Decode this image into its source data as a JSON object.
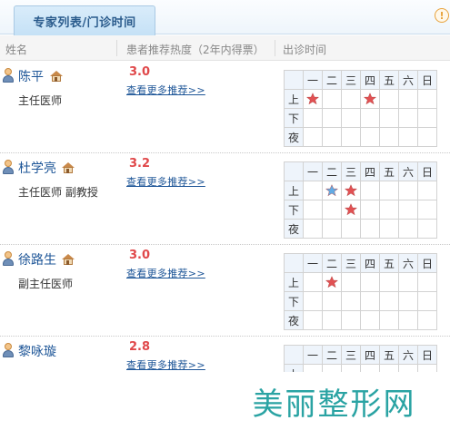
{
  "tab": {
    "label": "专家列表/门诊时间",
    "info_icon": "!"
  },
  "header": {
    "name_col": "姓名",
    "rating_col": "患者推荐热度（2年内得票）",
    "schedule_col": "出诊时间"
  },
  "schedule_labels": {
    "days": [
      "一",
      "二",
      "三",
      "四",
      "五",
      "六",
      "日"
    ],
    "slots": [
      "上",
      "下",
      "夜"
    ]
  },
  "doctors": [
    {
      "name": "陈平",
      "title": "主任医师",
      "score": "3.0",
      "more": "查看更多推荐>>",
      "schedule": [
        [
          "red",
          "",
          "",
          "red",
          "",
          "",
          ""
        ],
        [
          "",
          "",
          "",
          "",
          "",
          "",
          ""
        ],
        [
          "",
          "",
          "",
          "",
          "",
          "",
          ""
        ]
      ]
    },
    {
      "name": "杜学亮",
      "title": "主任医师  副教授",
      "score": "3.2",
      "more": "查看更多推荐>>",
      "schedule": [
        [
          "",
          "blue",
          "red",
          "",
          "",
          "",
          ""
        ],
        [
          "",
          "",
          "red",
          "",
          "",
          "",
          ""
        ],
        [
          "",
          "",
          "",
          "",
          "",
          "",
          ""
        ]
      ]
    },
    {
      "name": "徐路生",
      "title": "副主任医师",
      "score": "3.0",
      "more": "查看更多推荐>>",
      "schedule": [
        [
          "",
          "red",
          "",
          "",
          "",
          "",
          ""
        ],
        [
          "",
          "",
          "",
          "",
          "",
          "",
          ""
        ],
        [
          "",
          "",
          "",
          "",
          "",
          "",
          ""
        ]
      ]
    },
    {
      "name": "黎咏璇",
      "title": "",
      "score": "2.8",
      "more": "查看更多推荐>>",
      "schedule": [
        [
          "",
          "",
          "",
          "",
          "",
          "",
          ""
        ],
        [
          "",
          "",
          "",
          "",
          "",
          "",
          ""
        ],
        [
          "",
          "",
          "",
          "",
          "",
          "",
          ""
        ]
      ]
    }
  ],
  "watermark": "美丽整形网",
  "colors": {
    "star_red": "#e0484a",
    "star_blue": "#5aa7e3",
    "link": "#1d5597",
    "score": "#e0484a"
  }
}
